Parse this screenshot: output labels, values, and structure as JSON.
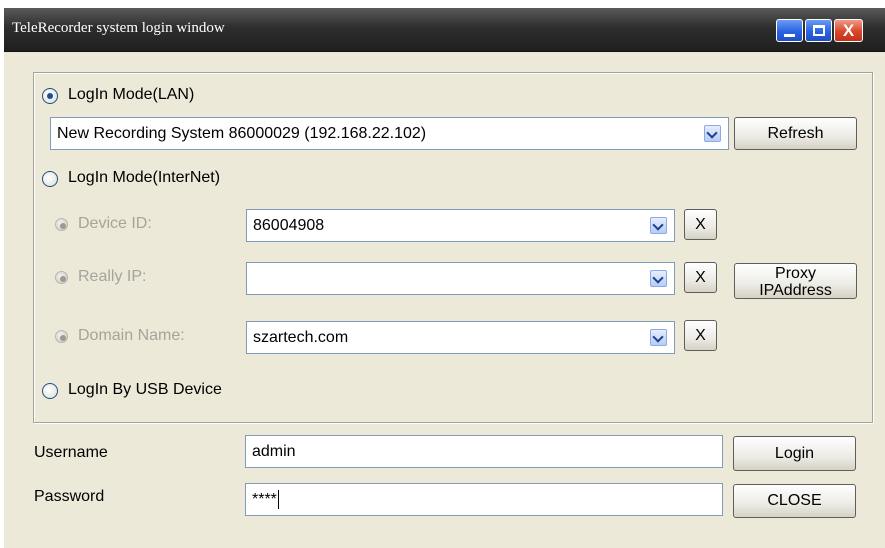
{
  "window": {
    "title": "TeleRecorder system login window",
    "close_glyph": "X"
  },
  "lan": {
    "radio_label": "LogIn Mode(LAN)",
    "selected": true,
    "device_value": "New Recording System 86000029 (192.168.22.102)",
    "refresh_label": "Refresh"
  },
  "internet": {
    "radio_label": "LogIn Mode(InterNet)",
    "selected": false,
    "device_id_label": "Device ID:",
    "device_id_value": "86004908",
    "really_ip_label": "Really IP:",
    "really_ip_value": "",
    "domain_label": "Domain Name:",
    "domain_value": "szartech.com",
    "clear_label": "X",
    "proxy_line1": "Proxy",
    "proxy_line2": "IPAddress"
  },
  "usb": {
    "radio_label": "LogIn By USB Device",
    "selected": false
  },
  "credentials": {
    "username_label": "Username",
    "username_value": "admin",
    "password_label": "Password",
    "password_value": "****",
    "login_label": "Login",
    "close_label": "CLOSE"
  }
}
